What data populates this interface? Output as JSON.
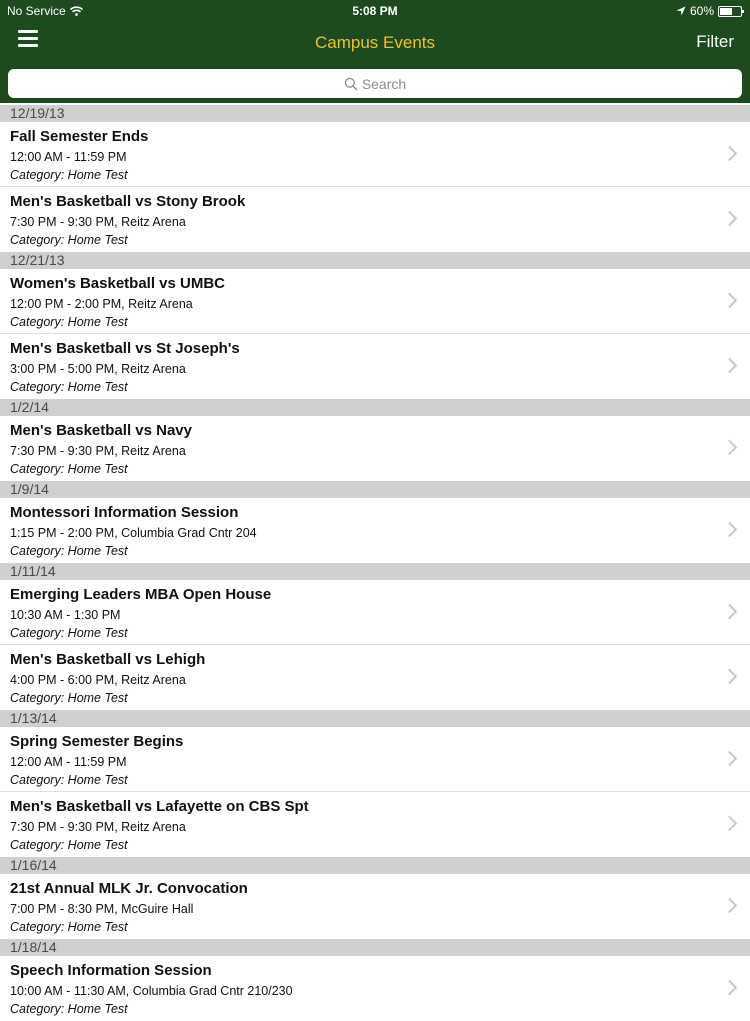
{
  "status_bar": {
    "carrier": "No Service",
    "time": "5:08 PM",
    "battery": "60%",
    "battery_level": 0.6
  },
  "nav": {
    "title": "Campus Events",
    "filter_label": "Filter",
    "menu_icon": "hamburger-menu-icon"
  },
  "search": {
    "placeholder": "Search",
    "value": ""
  },
  "colors": {
    "header_bg": "#1d4a1f",
    "title": "#f2c027",
    "section_bg": "#cfcfcf"
  },
  "sections": [
    {
      "date": "12/19/13",
      "events": [
        {
          "title": "Fall Semester Ends",
          "time": "12:00 AM - 11:59 PM",
          "category": "Category: Home Test"
        },
        {
          "title": "Men's Basketball vs Stony Brook",
          "time": "7:30 PM - 9:30 PM, Reitz Arena",
          "category": "Category: Home Test"
        }
      ]
    },
    {
      "date": "12/21/13",
      "events": [
        {
          "title": "Women's Basketball vs UMBC",
          "time": "12:00 PM - 2:00 PM, Reitz Arena",
          "category": "Category: Home Test"
        },
        {
          "title": "Men's Basketball vs St Joseph's",
          "time": "3:00 PM - 5:00 PM, Reitz Arena",
          "category": "Category: Home Test"
        }
      ]
    },
    {
      "date": "1/2/14",
      "events": [
        {
          "title": "Men's Basketball vs Navy",
          "time": "7:30 PM - 9:30 PM, Reitz Arena",
          "category": "Category: Home Test"
        }
      ]
    },
    {
      "date": "1/9/14",
      "events": [
        {
          "title": "Montessori Information Session",
          "time": "1:15 PM - 2:00 PM, Columbia Grad Cntr 204",
          "category": "Category: Home Test"
        }
      ]
    },
    {
      "date": "1/11/14",
      "events": [
        {
          "title": "Emerging Leaders MBA Open House",
          "time": "10:30 AM - 1:30 PM",
          "category": "Category: Home Test"
        },
        {
          "title": "Men's Basketball vs Lehigh",
          "time": "4:00 PM - 6:00 PM, Reitz Arena",
          "category": "Category: Home Test"
        }
      ]
    },
    {
      "date": "1/13/14",
      "events": [
        {
          "title": "Spring Semester Begins",
          "time": "12:00 AM - 11:59 PM",
          "category": "Category: Home Test"
        },
        {
          "title": "Men's Basketball vs Lafayette on CBS Spt",
          "time": "7:30 PM - 9:30 PM, Reitz Arena",
          "category": "Category: Home Test"
        }
      ]
    },
    {
      "date": "1/16/14",
      "events": [
        {
          "title": "21st Annual MLK Jr. Convocation",
          "time": "7:00 PM - 8:30 PM, McGuire Hall",
          "category": "Category: Home Test"
        }
      ]
    },
    {
      "date": "1/18/14",
      "events": [
        {
          "title": "Speech Information Session",
          "time": "10:00 AM - 11:30 AM, Columbia Grad Cntr 210/230",
          "category": "Category: Home Test"
        }
      ]
    }
  ]
}
